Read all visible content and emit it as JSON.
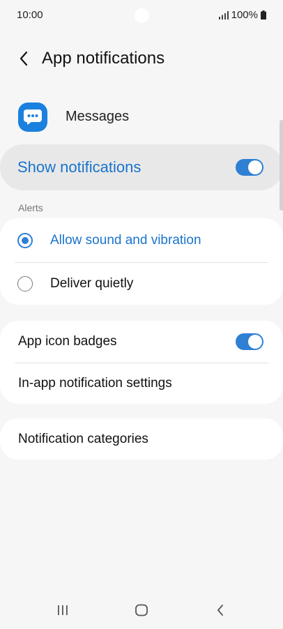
{
  "status_bar": {
    "time": "10:00",
    "battery": "100%"
  },
  "header": {
    "title": "App notifications"
  },
  "app": {
    "name": "Messages"
  },
  "show_notifications": {
    "label": "Show notifications",
    "enabled": true
  },
  "alerts": {
    "section_label": "Alerts",
    "options": [
      {
        "label": "Allow sound and vibration",
        "selected": true
      },
      {
        "label": "Deliver quietly",
        "selected": false
      }
    ]
  },
  "badges": {
    "label": "App icon badges",
    "enabled": true
  },
  "in_app": {
    "label": "In-app notification settings"
  },
  "categories": {
    "label": "Notification categories"
  },
  "colors": {
    "accent": "#2f7fd3",
    "accent_text": "#1a73cc",
    "app_icon": "#1b80de"
  },
  "icons": [
    "back-arrow-icon",
    "messages-app-icon",
    "signal-icon",
    "battery-icon",
    "recents-icon",
    "home-icon",
    "back-icon"
  ]
}
